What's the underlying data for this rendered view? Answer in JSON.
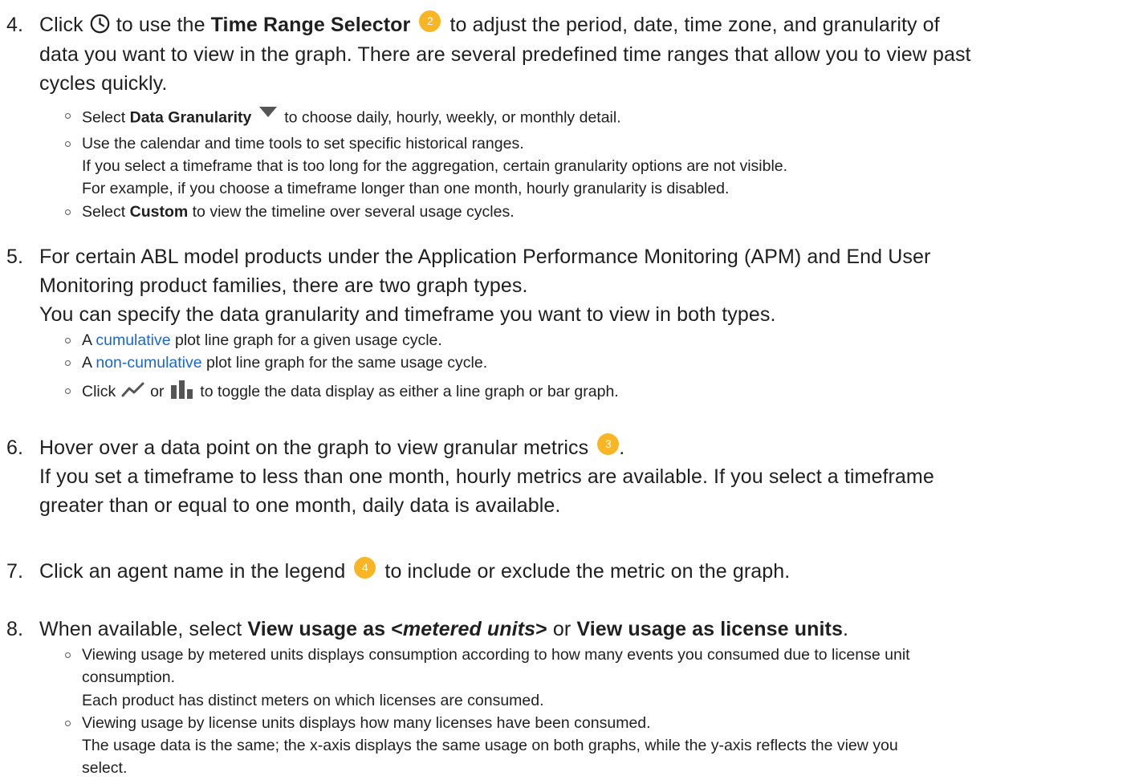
{
  "step4": {
    "number": "4.",
    "pre_icon": "Click",
    "icon": "clock-icon",
    "mid": "to use the",
    "bold": "Time Range Selector",
    "badge": "2",
    "post_line1": "to adjust the period, date, time zone, and granularity of",
    "line2": "data you want to view in the graph. There are several predefined time ranges that allow you to view past",
    "line3": "cycles quickly.",
    "bullets": {
      "b1_pre": "Select",
      "b1_bold": "Data Granularity",
      "b1_icon": "caret-down-icon",
      "b1_post": "to choose daily, hourly, weekly, or monthly detail.",
      "b2_line1": "Use the calendar and time tools to set specific historical ranges.",
      "b2_line2": "If you select a timeframe that is too long for the aggregation, certain granularity options are not visible.",
      "b2_line3": "For example, if you choose a timeframe longer than one month, hourly granularity is disabled.",
      "b3_pre": "Select",
      "b3_bold": "Custom",
      "b3_post": "to view the timeline over several usage cycles."
    }
  },
  "step5": {
    "number": "5.",
    "line1": "For certain ABL model products under the Application Performance Monitoring (APM) and End User",
    "line2": "Monitoring product families, there are two graph types.",
    "line3": "You can specify the data granularity and timeframe you want to view in both types.",
    "bullets": {
      "b1_pre": "A",
      "b1_link": "cumulative",
      "b1_post": "plot line graph for a given usage cycle.",
      "b2_pre": "A",
      "b2_link": "non-cumulative",
      "b2_post": "plot line graph for the same usage cycle.",
      "b3_pre": "Click",
      "b3_icon1": "line-chart-icon",
      "b3_or": "or",
      "b3_icon2": "bar-chart-icon",
      "b3_post": "to toggle the data display as either a line graph or bar graph."
    }
  },
  "step6": {
    "number": "6.",
    "line1": "Hover over a data point on the graph to view granular metrics",
    "badge": "3",
    "line1_end": ".",
    "line2": "If you set a timeframe to less than one month, hourly metrics are available. If you select a timeframe",
    "line3": "greater than or equal to one month, daily data is available."
  },
  "step7": {
    "number": "7.",
    "pre": "Click an agent name in the legend",
    "badge": "4",
    "post": "to include or exclude the metric on the graph."
  },
  "step8": {
    "number": "8.",
    "pre": "When available, select",
    "bold1": "View usage as <",
    "bold1_italic": "metered units",
    "bold1_end": ">",
    "or": "or",
    "bold2": "View usage as license units",
    "end": ".",
    "bullets": {
      "b1_line1": "Viewing usage by metered units displays consumption according to how many events you consumed due to license unit",
      "b1_line2": "consumption.",
      "b1_line3": "Each product has distinct meters on which licenses are consumed.",
      "b2_line1": "Viewing usage by license units displays how many licenses have been consumed.",
      "b2_line2": "The usage data is the same; the x-axis displays the same usage on both graphs, while the y-axis reflects the view you",
      "b2_line3": "select."
    }
  },
  "colors": {
    "text": "#1f1f1f",
    "link": "#1a66d6",
    "badge": "#f9b524",
    "icon": "#555555"
  }
}
